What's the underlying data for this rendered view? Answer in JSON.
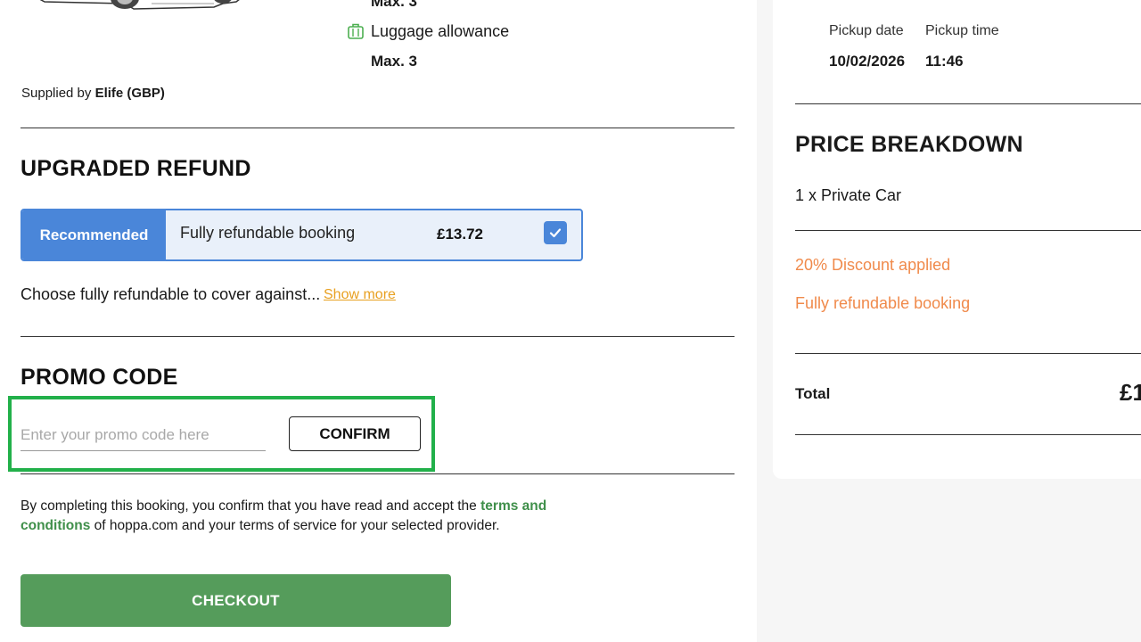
{
  "vehicle": {
    "capacity_top_value": "Max. 3",
    "luggage_label": "Luggage allowance",
    "luggage_value": "Max. 3",
    "supplied_prefix": "Supplied by",
    "supplier_name": "Elife (GBP)"
  },
  "refund": {
    "heading": "UPGRADED REFUND",
    "badge": "Recommended",
    "option_label": "Fully refundable booking",
    "price": "£13.72",
    "checked": true,
    "description": "Choose fully refundable to cover against...",
    "show_more": "Show more"
  },
  "promo": {
    "heading": "PROMO CODE",
    "placeholder": "Enter your promo code here",
    "value": "",
    "confirm_label": "CONFIRM"
  },
  "terms": {
    "before": "By completing this booking, you confirm that you have read and accept the",
    "link_line1": "terms and",
    "link_line2": "conditions",
    "after": "of hoppa.com and your terms of service for your selected provider."
  },
  "checkout_label": "CHECKOUT",
  "summary": {
    "pickup_date_label": "Pickup date",
    "pickup_date": "10/02/2026",
    "pickup_time_label": "Pickup time",
    "pickup_time": "11:46"
  },
  "price_breakdown": {
    "heading": "PRICE BREAKDOWN",
    "item": "1 x Private Car",
    "discount": "20% Discount applied",
    "refund_line": "Fully refundable booking",
    "total_label": "Total",
    "total_value_visible": "£1"
  },
  "colors": {
    "accent_blue": "#4a86d9",
    "checkout_green": "#559c5b",
    "link_green": "#3f8f4a",
    "highlight_orange": "#f08a4b",
    "show_more_yellow": "#e8a020",
    "promo_highlight": "#22b04a"
  }
}
